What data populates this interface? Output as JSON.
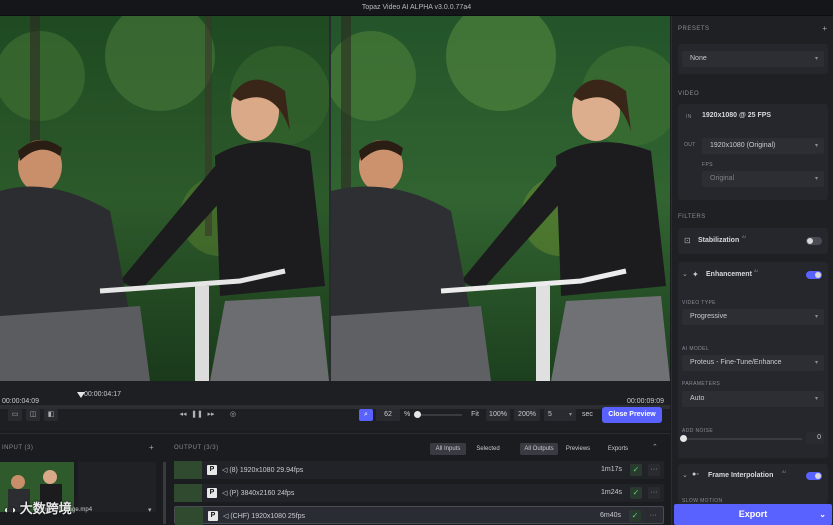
{
  "window": {
    "title": "Topaz Video AI ALPHA  v3.0.0.77a4"
  },
  "timeline": {
    "start": "00:00:04:09",
    "current": "00:00:04:17",
    "end": "00:00:09:09"
  },
  "preview_controls": {
    "zoom": "62",
    "zoom_unit": "%",
    "fit": "Fit",
    "z100": "100%",
    "z200": "200%",
    "sec_value": "5",
    "sec_unit": "sec",
    "close_preview": "Close Preview"
  },
  "input_panel": {
    "title": "INPUT (3)",
    "filename": "dm 9-1-footage.mp4"
  },
  "output_panel": {
    "title": "OUTPUT (3/3)",
    "filters1": [
      "All Inputs",
      "Selected"
    ],
    "filters2": [
      "All Outputs",
      "Previews",
      "Exports"
    ],
    "rows": [
      {
        "prefix": "P",
        "label": "◁ (8)  1920x1080  29.94fps",
        "duration": "1m17s"
      },
      {
        "prefix": "P",
        "label": "◁ (P)  3840x2160  24fps",
        "duration": "1m24s"
      },
      {
        "prefix": "P",
        "label": "◁ (CHF)  1920x1080  25fps",
        "duration": "6m40s"
      }
    ]
  },
  "sidebar": {
    "presets": {
      "label": "PRESETS",
      "value": "None"
    },
    "video": {
      "label": "VIDEO",
      "in_tag": "IN",
      "in_value": "1920x1080 @ 25 FPS",
      "out_tag": "OUT",
      "out_value": "1920x1080 (Original)",
      "fps_label": "FPS",
      "fps_value": "Original"
    },
    "filters_label": "FILTERS",
    "stabilization": {
      "label": "Stabilization",
      "badge": "AI",
      "enabled": false
    },
    "enhancement": {
      "label": "Enhancement",
      "badge": "AI",
      "enabled": true,
      "video_type_label": "VIDEO TYPE",
      "video_type": "Progressive",
      "ai_model_label": "AI MODEL",
      "ai_model": "Proteus - Fine-Tune/Enhance",
      "parameters_label": "PARAMETERS",
      "parameters": "Auto",
      "add_noise_label": "ADD NOISE",
      "add_noise_value": "0"
    },
    "frame_interpolation": {
      "label": "Frame Interpolation",
      "badge": "AI",
      "enabled": true,
      "slow_motion_label": "SLOW MOTION"
    },
    "export_label": "Export"
  },
  "watermark": {
    "text": "大数跨境"
  },
  "colors": {
    "accent": "#5962ff",
    "bg": "#1b1c20",
    "panel": "#1f2024"
  }
}
